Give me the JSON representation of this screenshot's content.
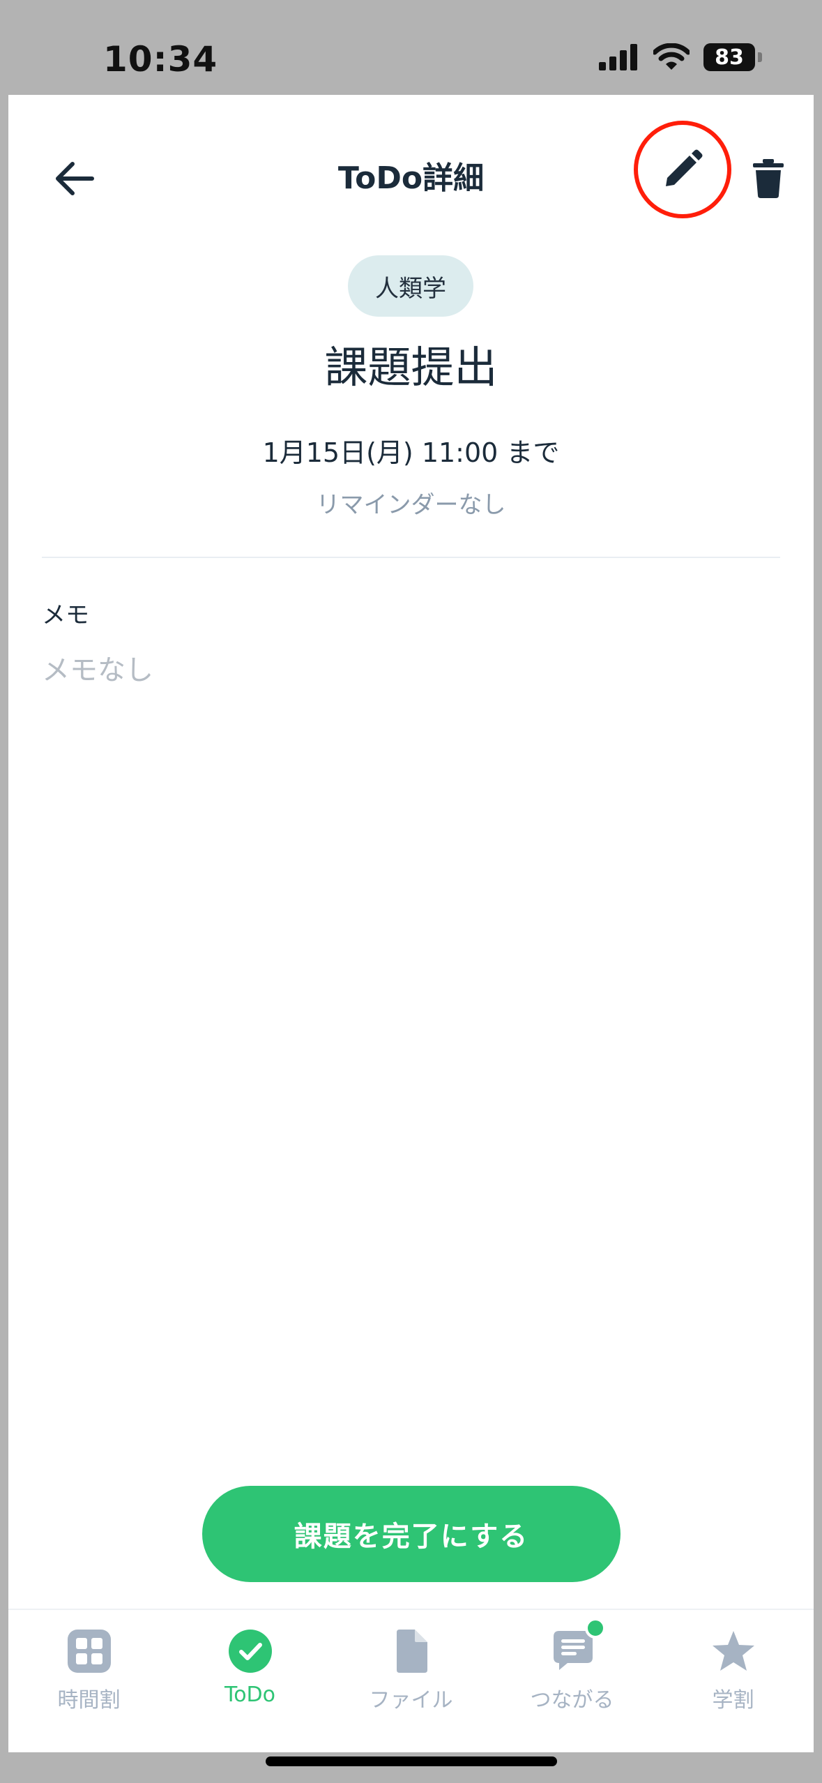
{
  "status_bar": {
    "time": "10:34",
    "battery": "83",
    "icons": [
      "cellular-signal-icon",
      "wifi-icon",
      "battery-icon"
    ]
  },
  "header": {
    "title": "ToDo詳細",
    "back_icon": "arrow-left-icon",
    "edit_icon": "pencil-icon",
    "delete_icon": "trash-icon",
    "highlight_color": "#ff1e0a"
  },
  "task": {
    "subject": "人類学",
    "title": "課題提出",
    "due": "1月15日(月) 11:00 まで",
    "reminder": "リマインダーなし",
    "memo_label": "メモ",
    "memo_value": "メモなし"
  },
  "actions": {
    "complete_label": "課題を完了にする",
    "accent_color": "#2ec474"
  },
  "tabbar": {
    "items": [
      {
        "label": "時間割",
        "icon": "timetable-icon",
        "active": false
      },
      {
        "label": "ToDo",
        "icon": "check-circle-icon",
        "active": true
      },
      {
        "label": "ファイル",
        "icon": "file-icon",
        "active": false
      },
      {
        "label": "つながる",
        "icon": "chat-icon",
        "active": false,
        "badge": true
      },
      {
        "label": "学割",
        "icon": "star-icon",
        "active": false
      }
    ]
  }
}
